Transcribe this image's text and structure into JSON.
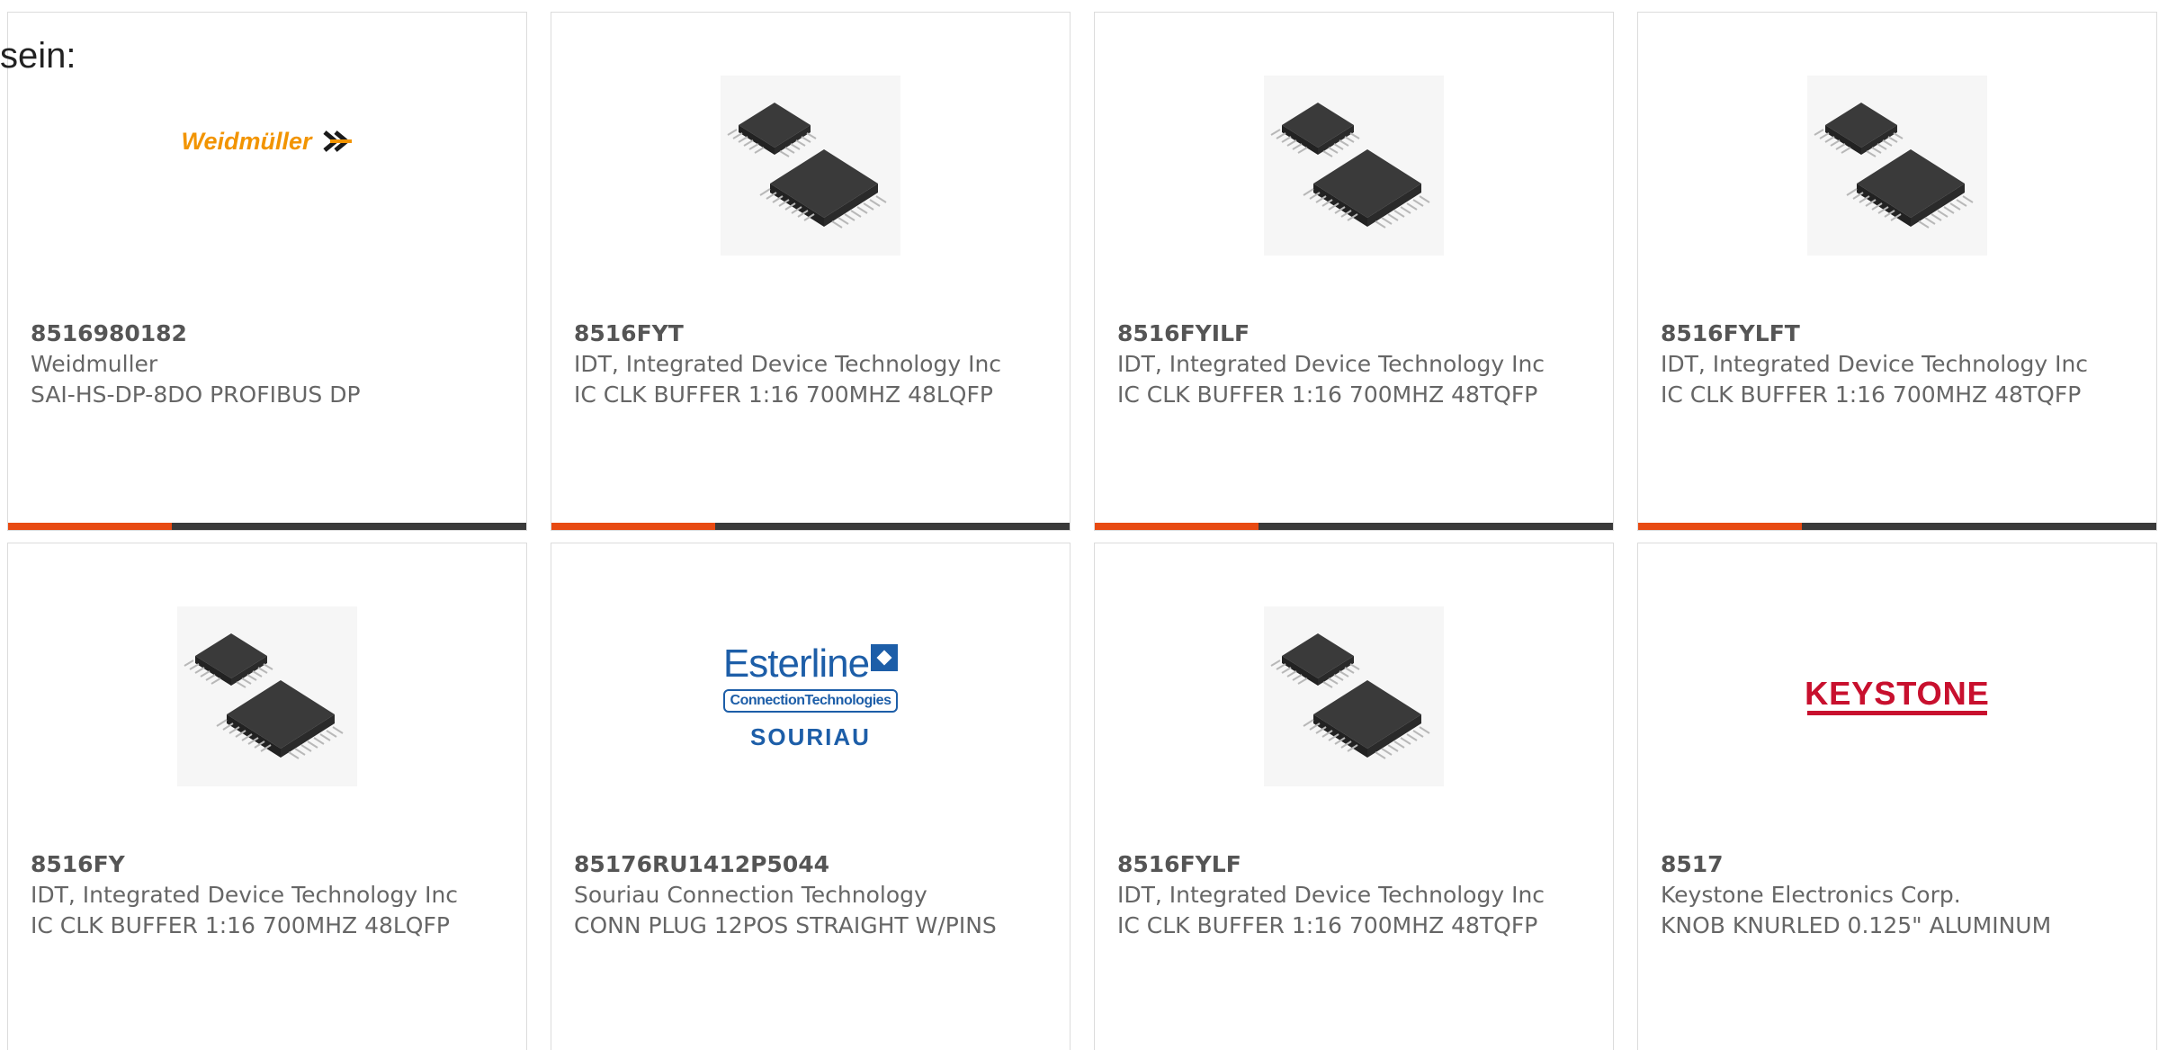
{
  "intro": {
    "text": "sein:"
  },
  "colors": {
    "accent": "#e84a12",
    "bar": "#3a3a3a",
    "text": "#666666"
  },
  "products": [
    {
      "part_number": "8516980182",
      "manufacturer": "Weidmuller",
      "description": "SAI-HS-DP-8DO PROFIBUS DP",
      "image": "weidmuller-logo",
      "logo_text": "Weidmüller"
    },
    {
      "part_number": "8516FYT",
      "manufacturer": "IDT, Integrated Device Technology Inc",
      "description": "IC CLK BUFFER 1:16 700MHZ 48LQFP",
      "image": "ic-chip-icon"
    },
    {
      "part_number": "8516FYILF",
      "manufacturer": "IDT, Integrated Device Technology Inc",
      "description": "IC CLK BUFFER 1:16 700MHZ 48TQFP",
      "image": "ic-chip-icon"
    },
    {
      "part_number": "8516FYLFT",
      "manufacturer": "IDT, Integrated Device Technology Inc",
      "description": "IC CLK BUFFER 1:16 700MHZ 48TQFP",
      "image": "ic-chip-icon"
    },
    {
      "part_number": "8516FY",
      "manufacturer": "IDT, Integrated Device Technology Inc",
      "description": "IC CLK BUFFER 1:16 700MHZ 48LQFP",
      "image": "ic-chip-icon"
    },
    {
      "part_number": "85176RU1412P5044",
      "manufacturer": "Souriau Connection Technology",
      "description": "CONN PLUG 12POS STRAIGHT W/PINS",
      "image": "esterline-souriau-logo",
      "logo_text": {
        "name": "Esterline",
        "sub": "ConnectionTechnologies",
        "brand": "SOURIAU"
      }
    },
    {
      "part_number": "8516FYLF",
      "manufacturer": "IDT, Integrated Device Technology Inc",
      "description": "IC CLK BUFFER 1:16 700MHZ 48TQFP",
      "image": "ic-chip-icon"
    },
    {
      "part_number": "8517",
      "manufacturer": "Keystone Electronics Corp.",
      "description": "KNOB KNURLED 0.125\" ALUMINUM",
      "image": "keystone-logo",
      "logo_text": {
        "name": "KEYSTONE"
      }
    }
  ]
}
